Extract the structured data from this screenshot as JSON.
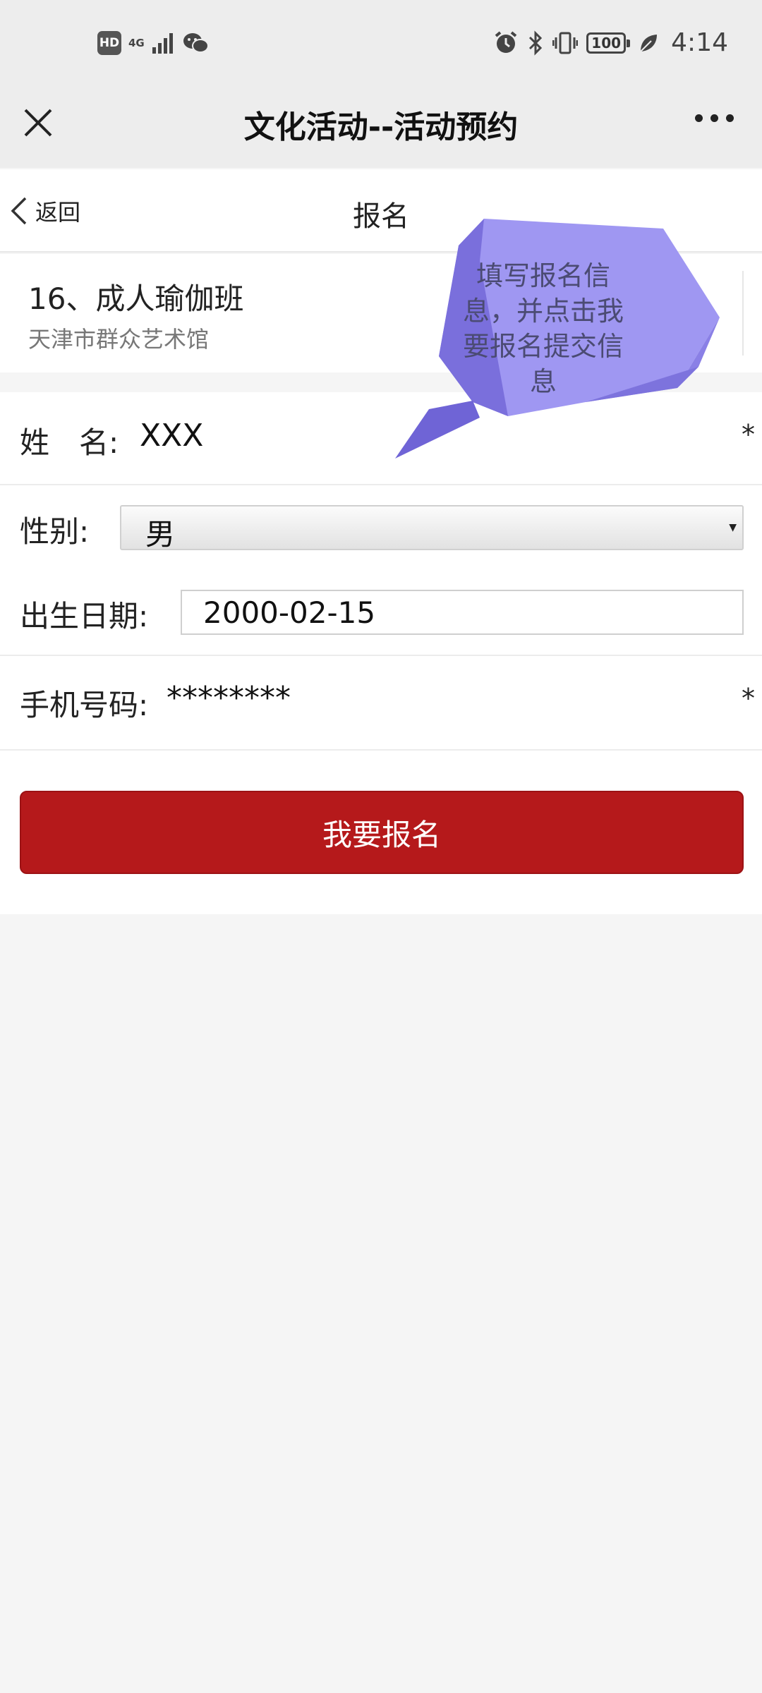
{
  "status_bar": {
    "hd": "HD",
    "network": "4G",
    "battery": "100",
    "time": "4:14"
  },
  "nav": {
    "title": "文化活动--活动预约"
  },
  "page": {
    "back_label": "返回",
    "title": "报名"
  },
  "activity": {
    "name": "16、成人瑜伽班",
    "venue": "天津市群众艺术馆"
  },
  "form": {
    "name_label": "姓　名:",
    "name_value": "XXX",
    "gender_label": "性别:",
    "gender_value": "男",
    "birth_label": "出生日期:",
    "birth_value": "2000-02-15",
    "phone_label": "手机号码:",
    "phone_value": "********",
    "required_mark": "*",
    "submit_label": "我要报名"
  },
  "annotation": {
    "text": "填写报名信息，并点击我要报名提交信息"
  },
  "colors": {
    "submit": "#b5191b",
    "bubble_light": "#9f97f2",
    "bubble_dark": "#6f64d6"
  }
}
